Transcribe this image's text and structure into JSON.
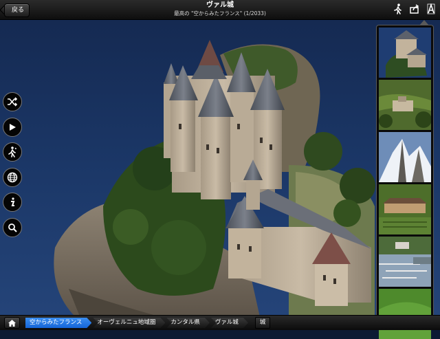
{
  "header": {
    "back_label": "戻る",
    "title": "ヴァル城",
    "subtitle": "最高の \"空からみたフランス\" (1/2033)",
    "icons": [
      "walker-icon",
      "share-icon",
      "font-size-icon"
    ]
  },
  "tools": [
    {
      "name": "shuffle-icon"
    },
    {
      "name": "play-icon"
    },
    {
      "name": "hiker-icon"
    },
    {
      "name": "globe-icon"
    },
    {
      "name": "info-icon"
    },
    {
      "name": "search-icon"
    }
  ],
  "thumbnails": [
    {
      "subject": "castle",
      "selected": true
    },
    {
      "subject": "village-in-valley"
    },
    {
      "subject": "snowy-mountain-peak"
    },
    {
      "subject": "chateau-with-garden"
    },
    {
      "subject": "coastal-harbor"
    },
    {
      "subject": "green-fields"
    }
  ],
  "breadcrumb": {
    "items": [
      "空からみたフランス",
      "オーヴェルニュ地域圏",
      "カンタル県",
      "ヴァル城"
    ],
    "tag": "城"
  },
  "colors": {
    "accent": "#1f77e6",
    "bar": "#1a1a1a",
    "water": "#1d3a6e"
  }
}
